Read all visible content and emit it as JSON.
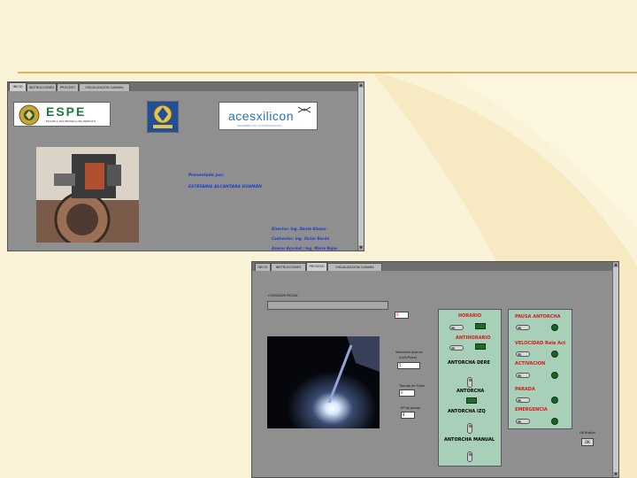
{
  "window1": {
    "tabs": [
      "INICIO",
      "INSTRUCCIONES",
      "PROCESO",
      "VISUALIZACION CAMARA"
    ],
    "active_tab": 0,
    "espe": {
      "title": "ESPE",
      "subtitle": "ESCUELA POLITÉCNICA DEL EJÉRCITO"
    },
    "aces": {
      "title": "acesxilicon",
      "subtitle": "INGENIERÍA EN AUTOMATIZACIÓN"
    },
    "presented_by_label": "Presentado por:",
    "author": "ESTÉFANIA ALCÁNTARA GUAMÁN",
    "credits": [
      "Director: Ing. Dante Alonso",
      "Codirector: Ing. Víctor Bacón",
      "Asesor Aca-Ind.: Ing. Mario Rojas"
    ]
  },
  "window2": {
    "tabs": [
      "INICIO",
      "INSTRUCCIONES",
      "PROCESO",
      "VISUALIZACION CAMARA"
    ],
    "active_tab": 2,
    "progress_label": "CONTADOR PIEZAS",
    "progress_value": "0",
    "speed_label": "Velocidad Avance",
    "speed_unit": "(Unit/Pulse)",
    "speed_value": "5",
    "pulse_label": "Tiempo de Pulse",
    "pulse_value": "0",
    "pieces_label": "Nº de piezas",
    "pieces_value": "4",
    "left_panel": {
      "horario": "HORARIO",
      "antihorario": "ANTIHORARIO",
      "antorcha_dere": "ANTORCHA DERE",
      "antorcha": "ANTORCHA",
      "antorcha_izq": "ANTORCHA IZQ",
      "antorcha_manual": "ANTORCHA MANUAL"
    },
    "right_panel": {
      "pausa": "PAUSA ANTORCHA",
      "velocidad": "VELOCIDAD Rele Act",
      "activacion": "ACTIVACION",
      "parada": "PARADA",
      "emergencia": "EMERGENCIA"
    },
    "ok_label": "OK Button",
    "ok_button": "OK"
  }
}
